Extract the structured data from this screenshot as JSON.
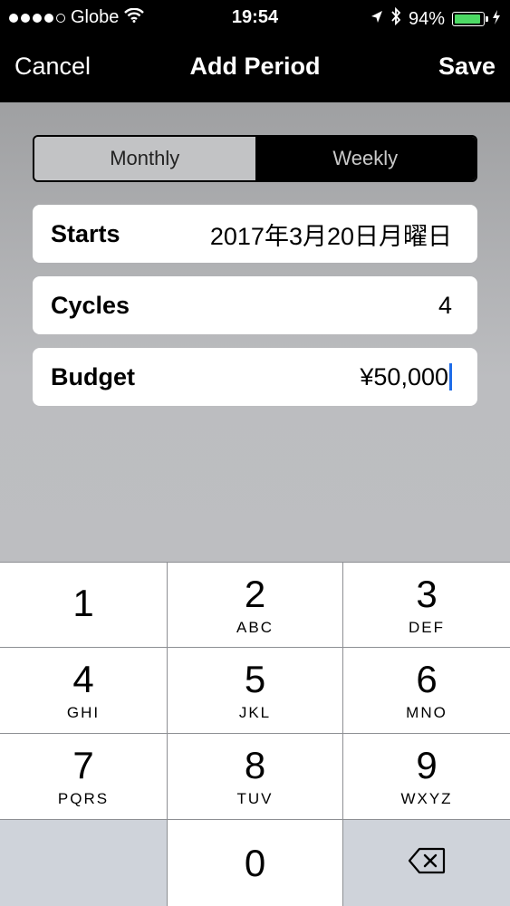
{
  "status_bar": {
    "carrier": "Globe",
    "signal_bars": 4,
    "signal_bars_total": 5,
    "time": "19:54",
    "battery_percent": "94%",
    "battery_level": 0.94,
    "icons": [
      "wifi-icon",
      "location-arrow-icon",
      "bluetooth-icon",
      "battery-icon",
      "charging-bolt-icon"
    ]
  },
  "nav": {
    "cancel_label": "Cancel",
    "title": "Add Period",
    "save_label": "Save"
  },
  "segmented": {
    "options": [
      "Monthly",
      "Weekly"
    ],
    "selected": "Weekly"
  },
  "form": {
    "starts": {
      "label": "Starts",
      "value": "2017年3月20日月曜日"
    },
    "cycles": {
      "label": "Cycles",
      "value": "4"
    },
    "budget": {
      "label": "Budget",
      "value": "¥50,000"
    }
  },
  "keypad": {
    "keys": [
      {
        "digit": "1",
        "letters": ""
      },
      {
        "digit": "2",
        "letters": "ABC"
      },
      {
        "digit": "3",
        "letters": "DEF"
      },
      {
        "digit": "4",
        "letters": "GHI"
      },
      {
        "digit": "5",
        "letters": "JKL"
      },
      {
        "digit": "6",
        "letters": "MNO"
      },
      {
        "digit": "7",
        "letters": "PQRS"
      },
      {
        "digit": "8",
        "letters": "TUV"
      },
      {
        "digit": "9",
        "letters": "WXYZ"
      },
      {
        "digit": "0",
        "letters": ""
      }
    ],
    "delete_icon": "backspace-icon"
  },
  "colors": {
    "bar_background": "#000000",
    "battery_fill": "#4cd964",
    "caret": "#1e6ce8",
    "content_background": "#bcbdc0",
    "keypad_special": "#cfd3da"
  }
}
